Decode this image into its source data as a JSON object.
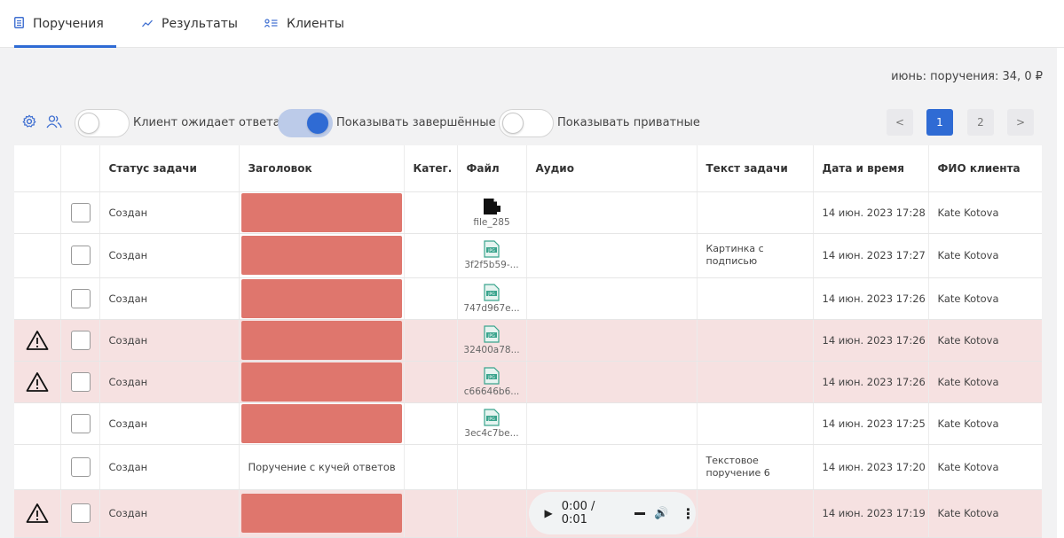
{
  "tabs": [
    {
      "label": "Поручения",
      "icon": "document-icon",
      "active": true
    },
    {
      "label": "Результаты",
      "icon": "trend-line-icon",
      "active": false
    },
    {
      "label": "Клиенты",
      "icon": "clients-list-icon",
      "active": false
    }
  ],
  "summary": "июнь: поручения: 34, 0 ₽",
  "toolbar": {
    "settings_icon": "gear-icon",
    "users_icon": "users-icon",
    "toggles": [
      {
        "label": "Клиент ожидает ответа",
        "on": false
      },
      {
        "label": "Показывать завершённые",
        "on": true
      },
      {
        "label": "Показывать приватные",
        "on": false
      }
    ]
  },
  "pagination": {
    "prev": "<",
    "pages": [
      "1",
      "2"
    ],
    "current": "1",
    "next": ">"
  },
  "table": {
    "columns": [
      "",
      "",
      "Статус задачи",
      "Заголовок",
      "Катег.",
      "Файл",
      "Аудио",
      "Текст задачи",
      "Дата и время",
      "ФИО клиента"
    ],
    "rows": [
      {
        "warning": false,
        "status": "Создан",
        "title": "",
        "redacted": true,
        "file": {
          "type": "generic",
          "name": "file_285"
        },
        "audio": null,
        "text": "",
        "datetime": "14 июн. 2023 17:28",
        "client": "Kate Kotova"
      },
      {
        "warning": false,
        "status": "Создан",
        "title": "",
        "redacted": true,
        "file": {
          "type": "jpg",
          "name": "3f2f5b59-..."
        },
        "audio": null,
        "text": "Картинка с подписью",
        "datetime": "14 июн. 2023 17:27",
        "client": "Kate Kotova"
      },
      {
        "warning": false,
        "status": "Создан",
        "title": "",
        "redacted": true,
        "file": {
          "type": "jpg",
          "name": "747d967e..."
        },
        "audio": null,
        "text": "",
        "datetime": "14 июн. 2023 17:26",
        "client": "Kate Kotova"
      },
      {
        "warning": true,
        "status": "Создан",
        "title": "",
        "redacted": true,
        "file": {
          "type": "jpg",
          "name": "32400a78..."
        },
        "audio": null,
        "text": "",
        "datetime": "14 июн. 2023 17:26",
        "client": "Kate Kotova"
      },
      {
        "warning": true,
        "status": "Создан",
        "title": "",
        "redacted": true,
        "file": {
          "type": "jpg",
          "name": "c66646b6..."
        },
        "audio": null,
        "text": "",
        "datetime": "14 июн. 2023 17:26",
        "client": "Kate Kotova"
      },
      {
        "warning": false,
        "status": "Создан",
        "title": "",
        "redacted": true,
        "file": {
          "type": "jpg",
          "name": "3ec4c7be..."
        },
        "audio": null,
        "text": "",
        "datetime": "14 июн. 2023 17:25",
        "client": "Kate Kotova"
      },
      {
        "warning": false,
        "status": "Создан",
        "title": "Поручение с кучей ответов",
        "redacted": false,
        "file": null,
        "audio": null,
        "text": "Текстовое поручение 6",
        "datetime": "14 июн. 2023 17:20",
        "client": "Kate Kotova"
      },
      {
        "warning": true,
        "status": "Создан",
        "title": "",
        "redacted": true,
        "file": null,
        "audio": {
          "time": "0:00 / 0:01"
        },
        "text": "",
        "datetime": "14 июн. 2023 17:19",
        "client": "Kate Kotova"
      }
    ]
  },
  "colors": {
    "accent": "#2f6bd4",
    "warning_row": "#f6e1e1",
    "redaction": "#df766d",
    "jpg_icon": "#3aa48d"
  }
}
